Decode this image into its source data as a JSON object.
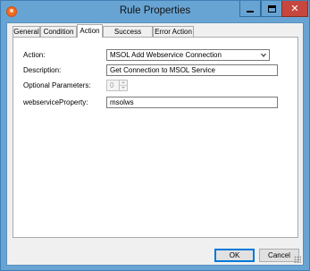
{
  "window": {
    "title": "Rule Properties",
    "controls": {
      "minimize_icon": "minimize-icon",
      "maximize_icon": "maximize-icon",
      "close_icon": "close-icon",
      "close_glyph": "✕"
    }
  },
  "tabs": [
    {
      "label": "General",
      "active": false
    },
    {
      "label": "Condition",
      "active": false
    },
    {
      "label": "Action",
      "active": true
    },
    {
      "label": "Success Action",
      "active": false
    },
    {
      "label": "Error Action",
      "active": false
    }
  ],
  "form": {
    "action": {
      "label": "Action:",
      "value": "MSOL Add Webservice Connection"
    },
    "description": {
      "label": "Description:",
      "value": "Get Connection to MSOL Service"
    },
    "optional_parameters": {
      "label": "Optional Parameters:",
      "value": "0"
    },
    "webservice_property": {
      "label": "webserviceProperty:",
      "value": "msolws"
    }
  },
  "buttons": {
    "ok": "OK",
    "cancel": "Cancel"
  },
  "colors": {
    "frame": "#68a4d3",
    "close": "#c7463d",
    "accent": "#0078d7",
    "app_icon": "#f26d21"
  }
}
